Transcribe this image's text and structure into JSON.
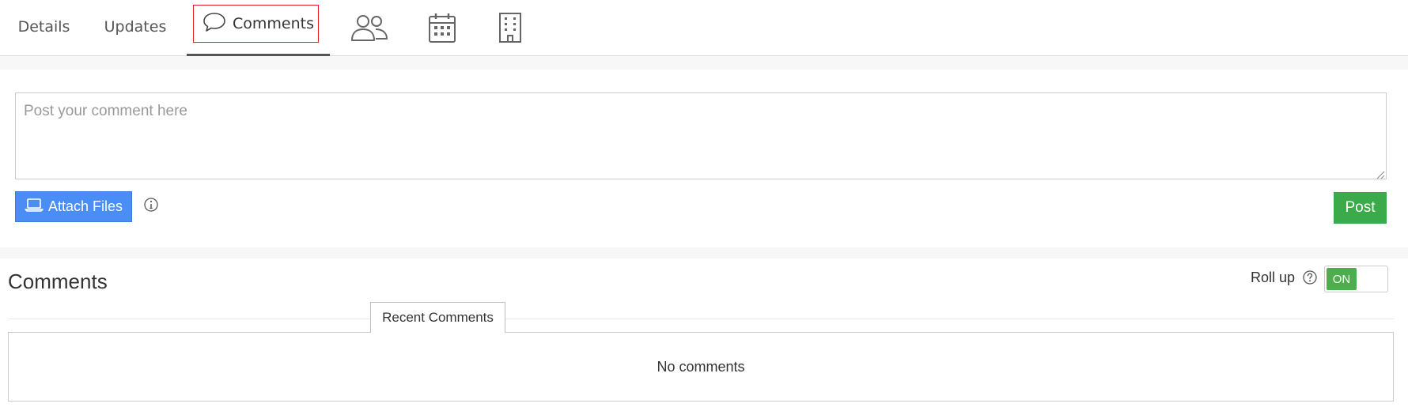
{
  "tabs": {
    "details": "Details",
    "updates": "Updates",
    "comments": "Comments",
    "icon_tabs": [
      "people-icon",
      "calendar-icon",
      "building-icon"
    ]
  },
  "composer": {
    "placeholder": "Post your comment here",
    "attach_label": "Attach Files",
    "post_label": "Post"
  },
  "comments_section": {
    "title": "Comments",
    "rollup_label": "Roll up",
    "toggle_state": "ON",
    "recent_tab": "Recent Comments",
    "empty_text": "No comments"
  },
  "colors": {
    "attach_button": "#4a8ef5",
    "post_button": "#3aaa4a",
    "toggle_on": "#4cae4c",
    "active_tab_underline": "#555555",
    "highlight_box": "#e0202a"
  }
}
